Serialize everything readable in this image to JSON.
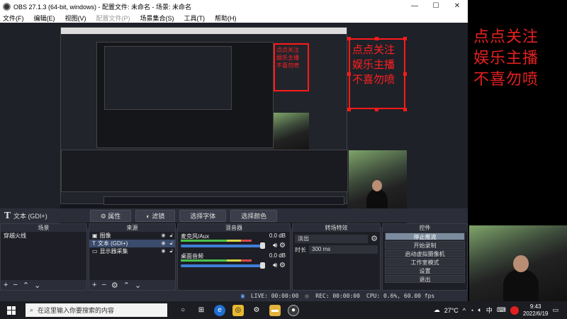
{
  "window": {
    "title": "OBS 27.1.3 (64-bit, windows) - 配置文件: 未命名 - 场景: 未命名",
    "min": "—",
    "max": "☐",
    "close": "✕"
  },
  "menu": [
    "文件(F)",
    "编辑(E)",
    "视图(V)",
    "配置文件(P)",
    "场景集合(S)",
    "工具(T)",
    "帮助(H)"
  ],
  "overlay": {
    "line1": "点点关注",
    "line2": "娱乐主播",
    "line3": "不喜勿喷"
  },
  "source_toolbar": {
    "source_name": "文本 (GDI+)",
    "properties": "属性",
    "filters": "滤镜",
    "select_font": "选择字体",
    "select_color": "选择颜色"
  },
  "scenes": {
    "title": "场景",
    "items": [
      "穿越火线"
    ]
  },
  "sources": {
    "title": "来源",
    "items": [
      {
        "icon": "image-icon",
        "label": "图像"
      },
      {
        "icon": "text-icon",
        "label": "文本 (GDI+)"
      },
      {
        "icon": "monitor-icon",
        "label": "显示器采集"
      }
    ]
  },
  "mixer": {
    "title": "混音器",
    "channels": [
      {
        "name": "麦克风/Aux",
        "db": "0.0 dB"
      },
      {
        "name": "桌面音频",
        "db": "0.0 dB"
      }
    ]
  },
  "transitions": {
    "title": "转场特效",
    "type": "淡出",
    "duration_label": "时长",
    "duration_value": "300 ms"
  },
  "controls": {
    "title": "控件",
    "buttons": [
      "停止推流",
      "开始录制",
      "启动虚拟摄像机",
      "工作室模式",
      "设置",
      "退出"
    ]
  },
  "status": {
    "live": "LIVE: 00:00:00",
    "rec": "REC: 00:00:00",
    "cpu": "CPU: 0.6%, 60.00 fps"
  },
  "taskbar": {
    "search_placeholder": "在这里输入你要搜索的内容",
    "weather": "27°C",
    "ime": "中",
    "time": "9:43",
    "date": "2022/6/19"
  },
  "colors": {
    "overlay_red": "#e52020",
    "obs_bg": "#2b2e38",
    "accent_blue": "#3f7ed8"
  }
}
